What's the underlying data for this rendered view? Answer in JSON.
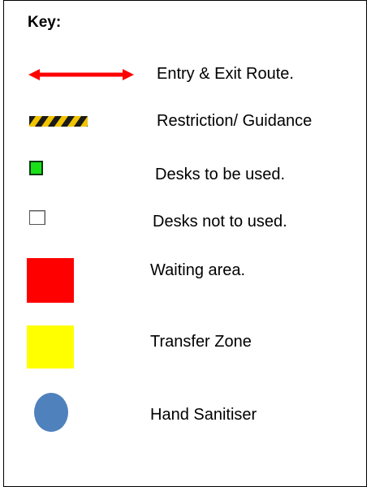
{
  "key": {
    "title": "Key:",
    "items": [
      {
        "symbol": "double-headed-arrow",
        "color": "#ff0000",
        "label": "Entry & Exit Route."
      },
      {
        "symbol": "hazard-tape",
        "colors": [
          "#1a1a1a",
          "#f2c400"
        ],
        "label": "Restriction/ Guidance"
      },
      {
        "symbol": "green-desk-square",
        "color": "#19e019",
        "label": "Desks to be used."
      },
      {
        "symbol": "white-desk-square",
        "color": "#ffffff",
        "label": "Desks not to used."
      },
      {
        "symbol": "red-square",
        "color": "#ff0000",
        "label": "Waiting area."
      },
      {
        "symbol": "yellow-square",
        "color": "#ffff00",
        "label": "Transfer Zone"
      },
      {
        "symbol": "blue-ellipse",
        "color": "#4f81bd",
        "label": "Hand Sanitiser"
      }
    ]
  }
}
